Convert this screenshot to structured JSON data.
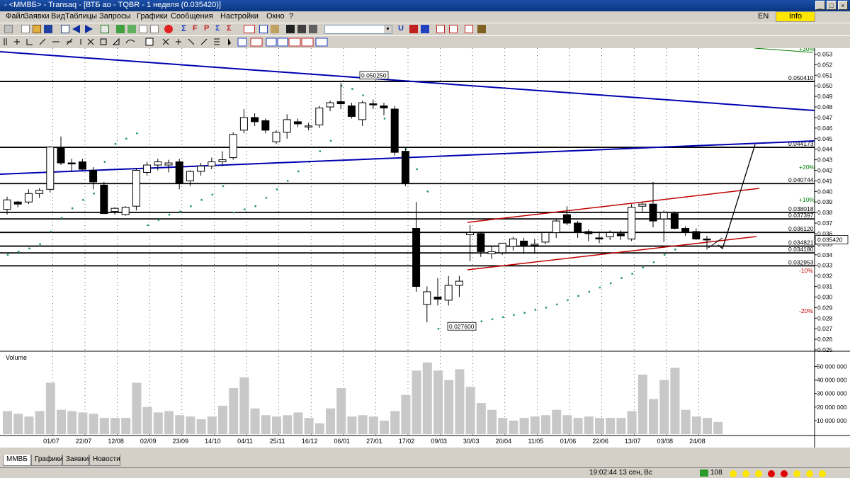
{
  "window": {
    "title": "- <ММВБ> - Transaq - [ВТБ ао - TQBR - 1 неделя (0.035420)]",
    "controls": [
      "_",
      "□",
      "×"
    ]
  },
  "menu": {
    "items": [
      "Файл",
      "Заявки",
      "Вид",
      "Таблицы",
      "Запросы",
      "Графики",
      "Сообщения",
      "Настройки",
      "Окно",
      "?"
    ],
    "lang": "EN",
    "info": "Info"
  },
  "toolbar": {
    "combo_value": "",
    "icons": [
      "new-icon",
      "open-icon",
      "save-icon",
      "table-icon",
      "back-icon",
      "forward-icon",
      "refresh-icon",
      "copy-icon",
      "paste-icon",
      "order-icon",
      "stop-icon",
      "sum-icon",
      "sigma-icon",
      "filter-icon",
      "idx-icon",
      "grid-icon",
      "chart-icon",
      "calc-icon",
      "u-icon",
      "p-icon",
      "news-icon",
      "briefcase-icon"
    ]
  },
  "chart": {
    "price_axis_ticks": [
      "0.053",
      "0.052",
      "0.051",
      "0.050",
      "0.049",
      "0.048",
      "0.047",
      "0.046",
      "0.045",
      "0.044",
      "0.043",
      "0.042",
      "0.041",
      "0.040",
      "0.039",
      "0.038",
      "0.037",
      "0.036",
      "0.035",
      "0.034",
      "0.033",
      "0.032",
      "0.031",
      "0.030",
      "0.029",
      "0.028",
      "0.027",
      "0.026",
      "0.025"
    ],
    "level_labels": [
      "0.050410",
      "0.044173",
      "0.040744",
      "0.038018",
      "0.037397",
      "0.036120",
      "0.034821",
      "0.034180",
      "0.032953"
    ],
    "current_price": "0.035420",
    "callouts": [
      "0.050250",
      "0.027600"
    ],
    "percent_labels": [
      "+30%",
      "+20%",
      "+10%",
      "-10%",
      "-20%"
    ],
    "date_labels": [
      "01/07",
      "22/07",
      "12/08",
      "02/09",
      "23/09",
      "14/10",
      "04/11",
      "25/11",
      "16/12",
      "06/01",
      "27/01",
      "17/02",
      "09/03",
      "30/03",
      "20/04",
      "11/05",
      "01/06",
      "22/06",
      "13/07",
      "03/08",
      "24/08"
    ],
    "volume_title": "Volume",
    "volume_ticks": [
      "50 000 000",
      "40 000 000",
      "30 000 000",
      "20 000 000",
      "10 000 000"
    ]
  },
  "chart_data": {
    "type": "candlestick",
    "title": "ВТБ ао - TQBR - 1 неделя",
    "ylim": [
      0.025,
      0.0535
    ],
    "candles": [
      [
        0.0383,
        0.0395,
        0.0378,
        0.0392
      ],
      [
        0.039,
        0.0391,
        0.0385,
        0.0388
      ],
      [
        0.039,
        0.0402,
        0.0388,
        0.0398
      ],
      [
        0.0398,
        0.0403,
        0.0394,
        0.0401
      ],
      [
        0.0402,
        0.0443,
        0.0399,
        0.0442
      ],
      [
        0.0441,
        0.0452,
        0.0425,
        0.0427
      ],
      [
        0.0427,
        0.0431,
        0.0419,
        0.0426
      ],
      [
        0.0428,
        0.0431,
        0.042,
        0.0421
      ],
      [
        0.042,
        0.0423,
        0.0402,
        0.0409
      ],
      [
        0.0406,
        0.0409,
        0.0379,
        0.0379
      ],
      [
        0.0381,
        0.0385,
        0.0378,
        0.0384
      ],
      [
        0.0378,
        0.0386,
        0.0377,
        0.0385
      ],
      [
        0.0386,
        0.0422,
        0.0382,
        0.042
      ],
      [
        0.0418,
        0.0428,
        0.0415,
        0.0425
      ],
      [
        0.0425,
        0.0431,
        0.042,
        0.0428
      ],
      [
        0.0425,
        0.043,
        0.0418,
        0.0427
      ],
      [
        0.0428,
        0.0431,
        0.0402,
        0.0408
      ],
      [
        0.041,
        0.042,
        0.0405,
        0.0419
      ],
      [
        0.0419,
        0.0427,
        0.0415,
        0.0424
      ],
      [
        0.0424,
        0.0432,
        0.0421,
        0.0428
      ],
      [
        0.0428,
        0.0438,
        0.0424,
        0.043
      ],
      [
        0.0432,
        0.0456,
        0.043,
        0.0454
      ],
      [
        0.0458,
        0.0478,
        0.0455,
        0.047
      ],
      [
        0.047,
        0.0474,
        0.0462,
        0.0466
      ],
      [
        0.0467,
        0.0469,
        0.0455,
        0.0458
      ],
      [
        0.0447,
        0.0458,
        0.0445,
        0.0456
      ],
      [
        0.0456,
        0.0473,
        0.045,
        0.0468
      ],
      [
        0.0466,
        0.0469,
        0.0461,
        0.0464
      ],
      [
        0.0461,
        0.0465,
        0.0458,
        0.0462
      ],
      [
        0.0463,
        0.0481,
        0.046,
        0.0479
      ],
      [
        0.048,
        0.0486,
        0.0476,
        0.0484
      ],
      [
        0.0485,
        0.0503,
        0.0478,
        0.0483
      ],
      [
        0.0481,
        0.0484,
        0.0469,
        0.0471
      ],
      [
        0.0468,
        0.0486,
        0.0462,
        0.0484
      ],
      [
        0.0483,
        0.0487,
        0.0478,
        0.0482
      ],
      [
        0.0481,
        0.0484,
        0.0472,
        0.0479
      ],
      [
        0.0478,
        0.0481,
        0.0434,
        0.0437
      ],
      [
        0.0438,
        0.0441,
        0.0405,
        0.0408
      ],
      [
        0.0365,
        0.039,
        0.0305,
        0.031
      ],
      [
        0.0293,
        0.031,
        0.0276,
        0.0305
      ],
      [
        0.03,
        0.0318,
        0.0292,
        0.0298
      ],
      [
        0.0297,
        0.032,
        0.0292,
        0.0311
      ],
      [
        0.0311,
        0.032,
        0.03,
        0.0315
      ],
      [
        0.0359,
        0.0368,
        0.0334,
        0.0361
      ],
      [
        0.036,
        0.0362,
        0.0338,
        0.0343
      ],
      [
        0.0341,
        0.0348,
        0.0336,
        0.0343
      ],
      [
        0.0342,
        0.0351,
        0.034,
        0.0351
      ],
      [
        0.0348,
        0.0357,
        0.0344,
        0.0355
      ],
      [
        0.0353,
        0.0356,
        0.0341,
        0.0349
      ],
      [
        0.0349,
        0.0355,
        0.0341,
        0.035
      ],
      [
        0.0352,
        0.0362,
        0.035,
        0.0361
      ],
      [
        0.0361,
        0.0374,
        0.0356,
        0.0372
      ],
      [
        0.0378,
        0.0386,
        0.0368,
        0.037
      ],
      [
        0.037,
        0.0372,
        0.0356,
        0.0361
      ],
      [
        0.0362,
        0.0364,
        0.0353,
        0.036
      ],
      [
        0.0356,
        0.0362,
        0.0351,
        0.0355
      ],
      [
        0.0357,
        0.0363,
        0.0354,
        0.0361
      ],
      [
        0.036,
        0.0363,
        0.0354,
        0.0358
      ],
      [
        0.0355,
        0.0388,
        0.0353,
        0.0385
      ],
      [
        0.0386,
        0.039,
        0.0381,
        0.0388
      ],
      [
        0.0388,
        0.0409,
        0.0366,
        0.0372
      ],
      [
        0.0374,
        0.0382,
        0.0352,
        0.038
      ],
      [
        0.0379,
        0.0381,
        0.0364,
        0.0365
      ],
      [
        0.0365,
        0.0367,
        0.0358,
        0.0361
      ],
      [
        0.0362,
        0.0365,
        0.0354,
        0.0355
      ],
      [
        0.0355,
        0.0358,
        0.0345,
        0.0354
      ]
    ],
    "volume": [
      17,
      15,
      13,
      17,
      38,
      18,
      17,
      16,
      15,
      12,
      12,
      12,
      38,
      20,
      16,
      17,
      14,
      13,
      11,
      13,
      21,
      34,
      42,
      19,
      14,
      13,
      14,
      16,
      12,
      8,
      19,
      34,
      13,
      14,
      13,
      10,
      17,
      29,
      47,
      53,
      47,
      40,
      48,
      35,
      23,
      18,
      12,
      10,
      12,
      13,
      14,
      18,
      14,
      12,
      13,
      12,
      12,
      12,
      17,
      44,
      26,
      40,
      49,
      18,
      13,
      12,
      9
    ],
    "horizontal_levels": [
      0.05041,
      0.044173,
      0.040744,
      0.038018,
      0.037397,
      0.03612,
      0.034821,
      0.03418,
      0.032953
    ],
    "sar": [
      0.034,
      0.0343,
      0.0346,
      0.035,
      0.0362,
      0.0375,
      0.0384,
      0.0392,
      0.0398,
      0.0428,
      0.0445,
      0.045,
      0.0455,
      0.0368,
      0.0373,
      0.0378,
      0.0381,
      0.0386,
      0.0392,
      0.0397,
      0.0405,
      0.038,
      0.0383,
      0.0386,
      0.0394,
      0.0402,
      0.041,
      0.0419,
      0.0428,
      0.0438,
      0.0448,
      0.05,
      0.0497,
      0.0491,
      0.0482,
      0.0469,
      0.0456,
      0.044,
      0.0421,
      0.04,
      0.027,
      0.0272,
      0.0273,
      0.0275,
      0.0277,
      0.0279,
      0.0281,
      0.0283,
      0.0285,
      0.0288,
      0.029,
      0.0293,
      0.0297,
      0.0301,
      0.0305,
      0.0309,
      0.0313,
      0.0318,
      0.0322,
      0.0328,
      0.0333,
      0.034,
      0.0345
    ]
  }
}
